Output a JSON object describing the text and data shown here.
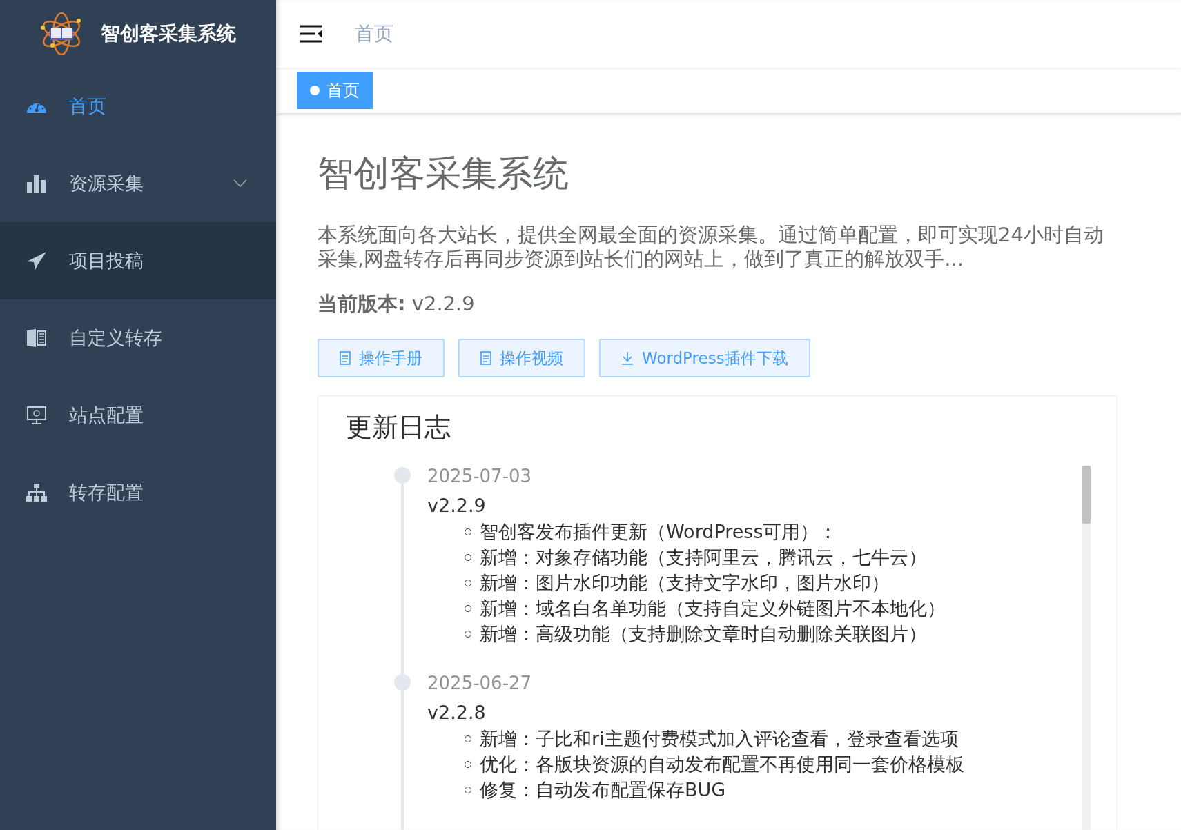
{
  "sidebar": {
    "logo_text": "智创客采集系统",
    "items": [
      {
        "label": "首页",
        "kind": "link",
        "selected": true,
        "hovered": false
      },
      {
        "label": "资源采集",
        "kind": "submenu",
        "selected": false,
        "hovered": false,
        "expanded": false
      },
      {
        "label": "项目投稿",
        "kind": "link",
        "selected": false,
        "hovered": true
      },
      {
        "label": "自定义转存",
        "kind": "link",
        "selected": false,
        "hovered": false
      },
      {
        "label": "站点配置",
        "kind": "link",
        "selected": false,
        "hovered": false
      },
      {
        "label": "转存配置",
        "kind": "link",
        "selected": false,
        "hovered": false
      }
    ]
  },
  "header": {
    "breadcrumb": "首页"
  },
  "tags": [
    {
      "label": "首页",
      "selected": true
    }
  ],
  "main": {
    "title": "智创客采集系统",
    "description": "本系统面向各大站长，提供全网最全面的资源采集。通过简单配置，即可实现24小时自动采集,网盘转存后再同步资源到站长们的网站上，做到了真正的解放双手...",
    "version_label": "当前版本:",
    "version": "v2.2.9",
    "buttons": [
      "操作手册",
      "操作视频",
      "WordPress插件下载"
    ],
    "changelog": {
      "title": "更新日志",
      "entries": [
        {
          "date": "2025-07-03",
          "version": "v2.2.9",
          "items": [
            "智创客发布插件更新（WordPress可用）：",
            "新增：对象存储功能（支持阿里云，腾讯云，七牛云）",
            "新增：图片水印功能（支持文字水印，图片水印）",
            "新增：域名白名单功能（支持自定义外链图片不本地化）",
            "新增：高级功能（支持删除文章时自动删除关联图片）"
          ]
        },
        {
          "date": "2025-06-27",
          "version": "v2.2.8",
          "items": [
            "新增：子比和ri主题付费模式加入评论查看，登录查看选项",
            "优化：各版块资源的自动发布配置不再使用同一套价格模板",
            "修复：自动发布配置保存BUG"
          ]
        }
      ]
    }
  }
}
